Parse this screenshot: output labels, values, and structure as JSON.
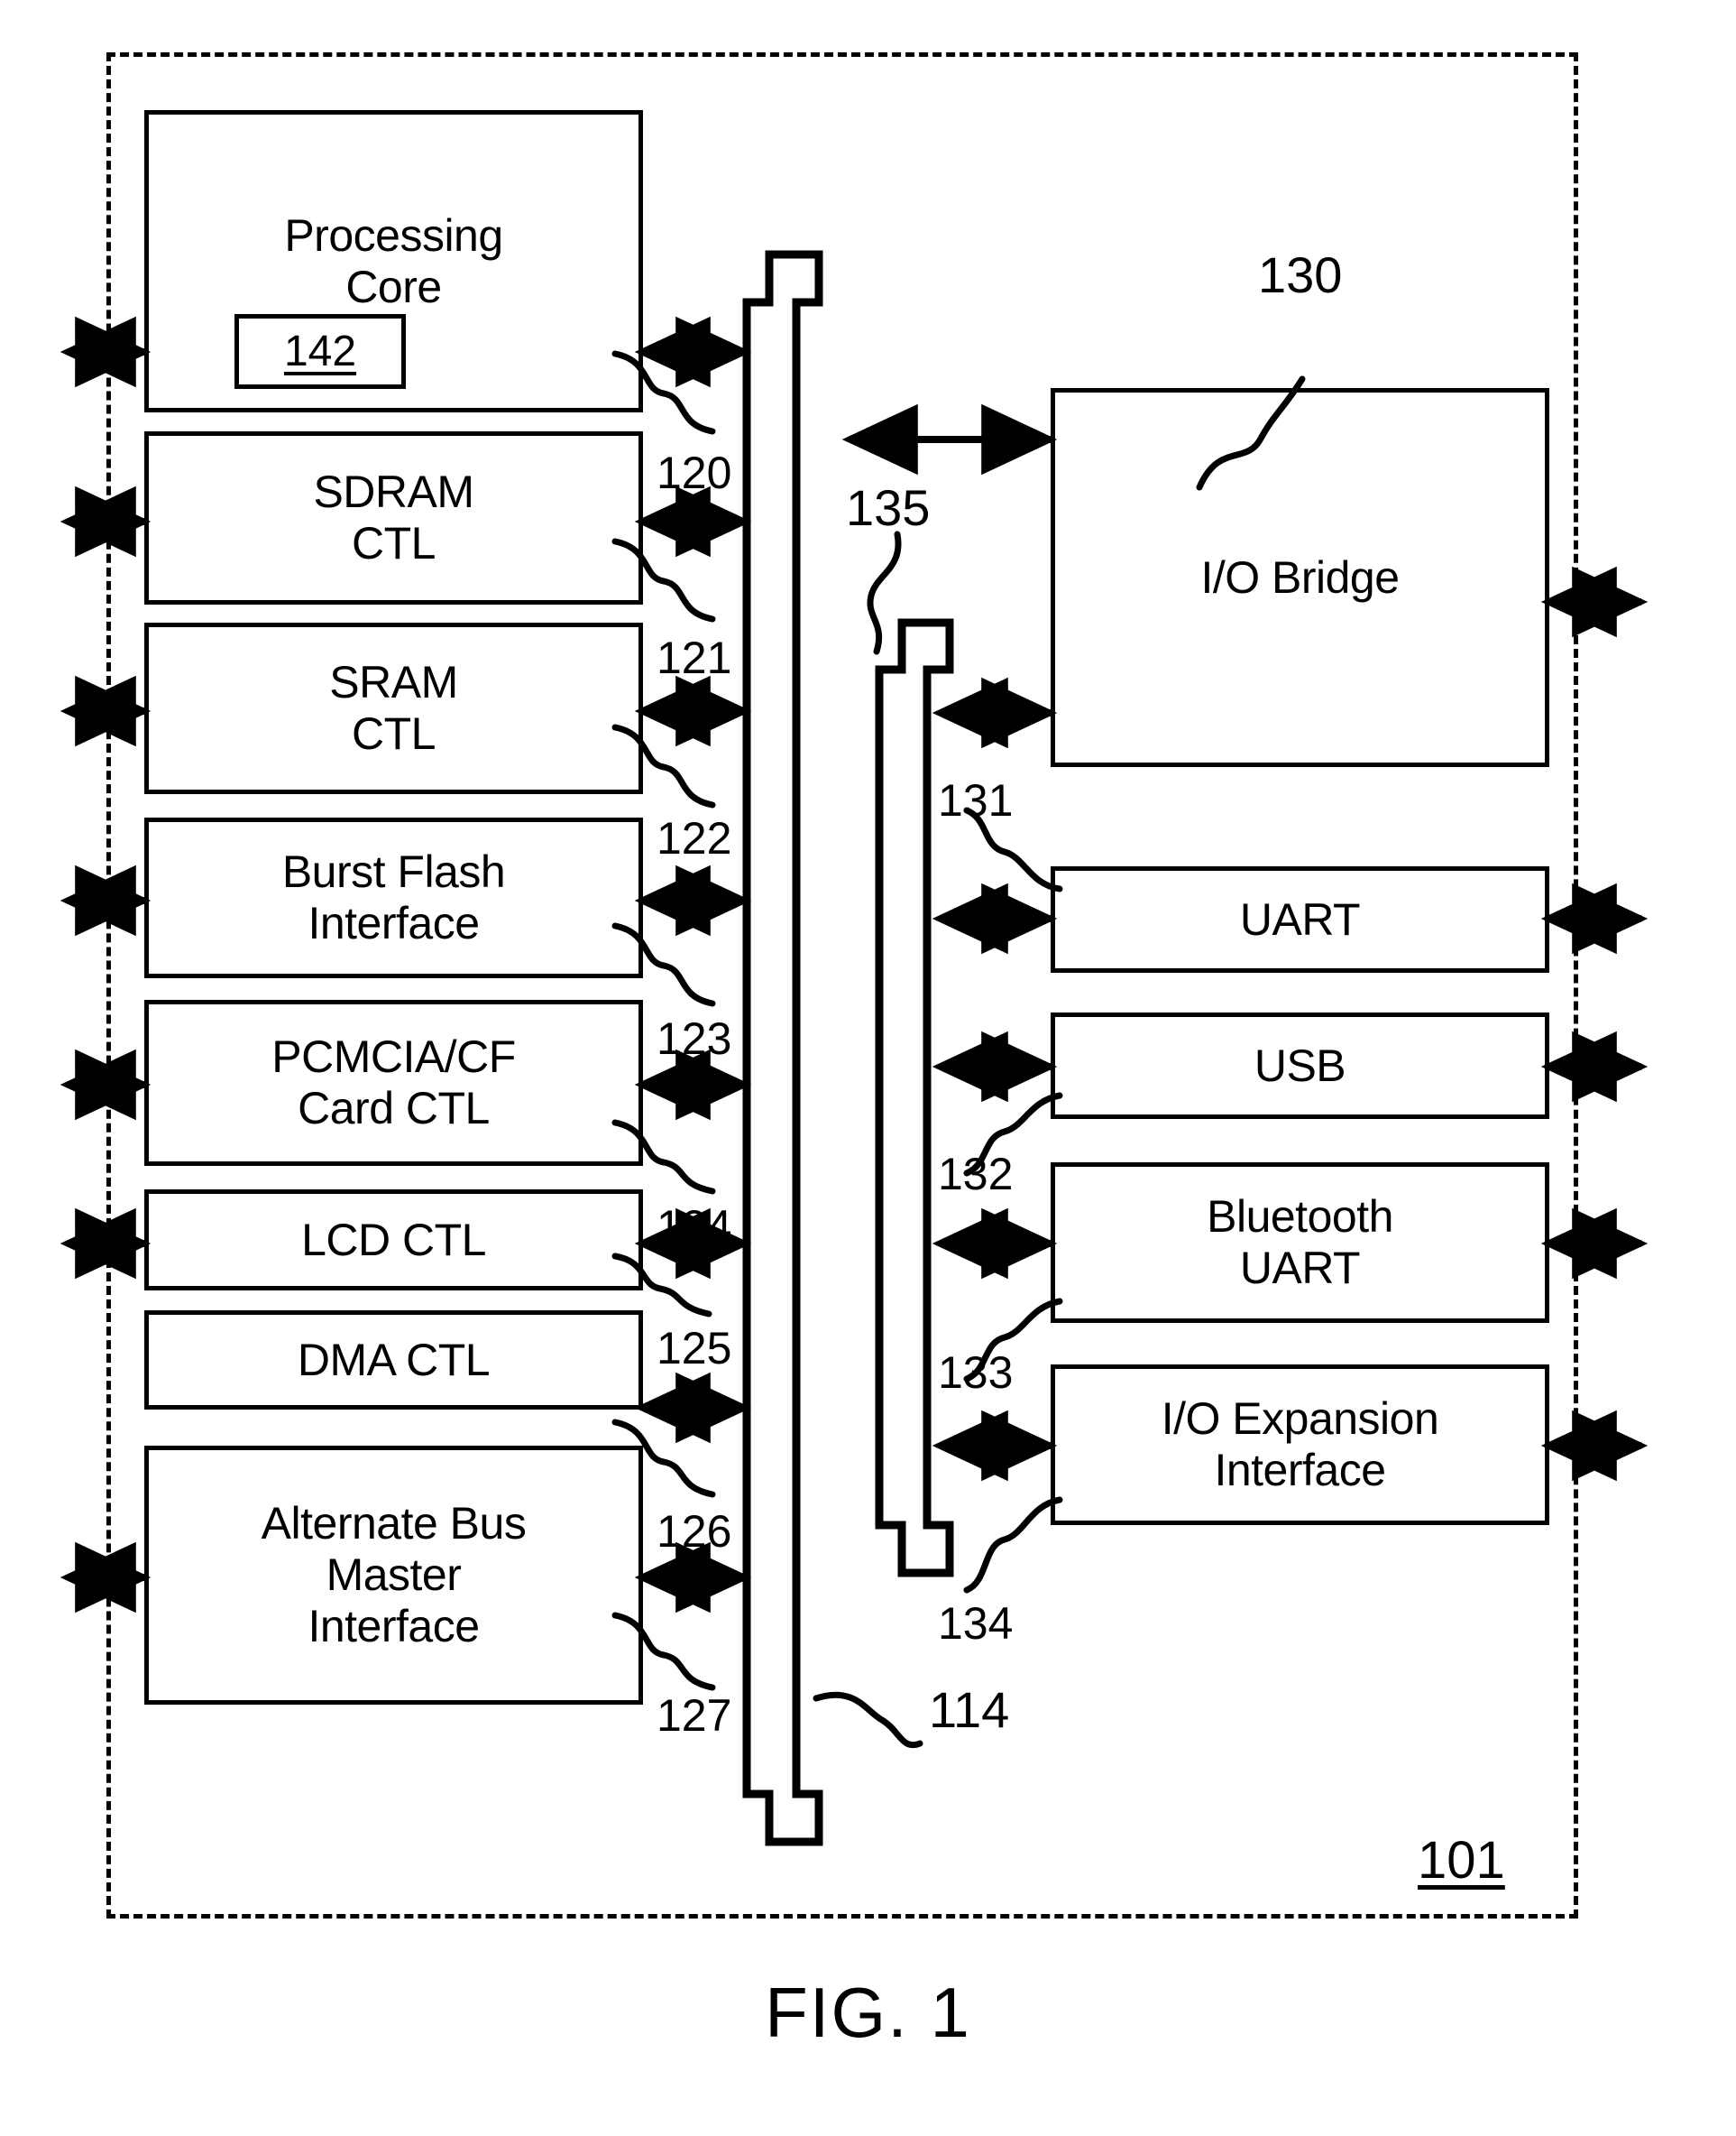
{
  "figure": {
    "caption": "FIG. 1",
    "chip_ref": "101",
    "bus_ref": "114",
    "second_bus_ref": "135"
  },
  "left_blocks": [
    {
      "label": "Processing\nCore",
      "ref": "120",
      "inner_ref": "142"
    },
    {
      "label": "SDRAM\nCTL",
      "ref": "121"
    },
    {
      "label": "SRAM\nCTL",
      "ref": "122"
    },
    {
      "label": "Burst Flash\nInterface",
      "ref": "123"
    },
    {
      "label": "PCMCIA/CF\nCard CTL",
      "ref": "124"
    },
    {
      "label": "LCD CTL",
      "ref": "125"
    },
    {
      "label": "DMA CTL",
      "ref": "126"
    },
    {
      "label": "Alternate Bus\nMaster\nInterface",
      "ref": "127"
    }
  ],
  "right_blocks": [
    {
      "label": "I/O Bridge",
      "ref": "130"
    },
    {
      "label": "UART",
      "ref": "131"
    },
    {
      "label": "USB",
      "ref": "132"
    },
    {
      "label": "Bluetooth\nUART",
      "ref": "133"
    },
    {
      "label": "I/O Expansion\nInterface",
      "ref": "134"
    }
  ],
  "colors": {
    "ink": "#000000",
    "paper": "#ffffff"
  }
}
